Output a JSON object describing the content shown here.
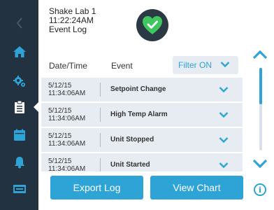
{
  "header": {
    "device_name": "Shake Lab 1",
    "time": "11:22:24AM",
    "screen_title": "Event Log",
    "status_icon": "check-heart-icon"
  },
  "sidebar": {
    "items": [
      {
        "icon": "back-chevron-icon"
      },
      {
        "icon": "home-icon"
      },
      {
        "icon": "gears-icon"
      },
      {
        "icon": "clipboard-icon",
        "active": true
      },
      {
        "icon": "calendar-icon"
      },
      {
        "icon": "bell-icon"
      },
      {
        "icon": "monitor-icon"
      }
    ]
  },
  "table": {
    "col_date": "Date/Time",
    "col_event": "Event",
    "filter_label": "Filter ON",
    "rows": [
      {
        "date": "5/12/15",
        "time": "11:34:06AM",
        "event": "Setpoint Change"
      },
      {
        "date": "5/12/15",
        "time": "11:34:06AM",
        "event": "High Temp Alarm"
      },
      {
        "date": "5/12/15",
        "time": "11:34:06AM",
        "event": "Unit Stopped"
      },
      {
        "date": "5/12/15",
        "time": "11:34:06AM",
        "event": "Unit Started"
      }
    ]
  },
  "actions": {
    "export_label": "Export Log",
    "view_chart_label": "View Chart",
    "info_label": "i"
  },
  "colors": {
    "accent": "#2ea3d5",
    "sidebar_bg": "#233240",
    "row_bg": "#e6ecf2",
    "status_ok": "#3fc65f"
  }
}
